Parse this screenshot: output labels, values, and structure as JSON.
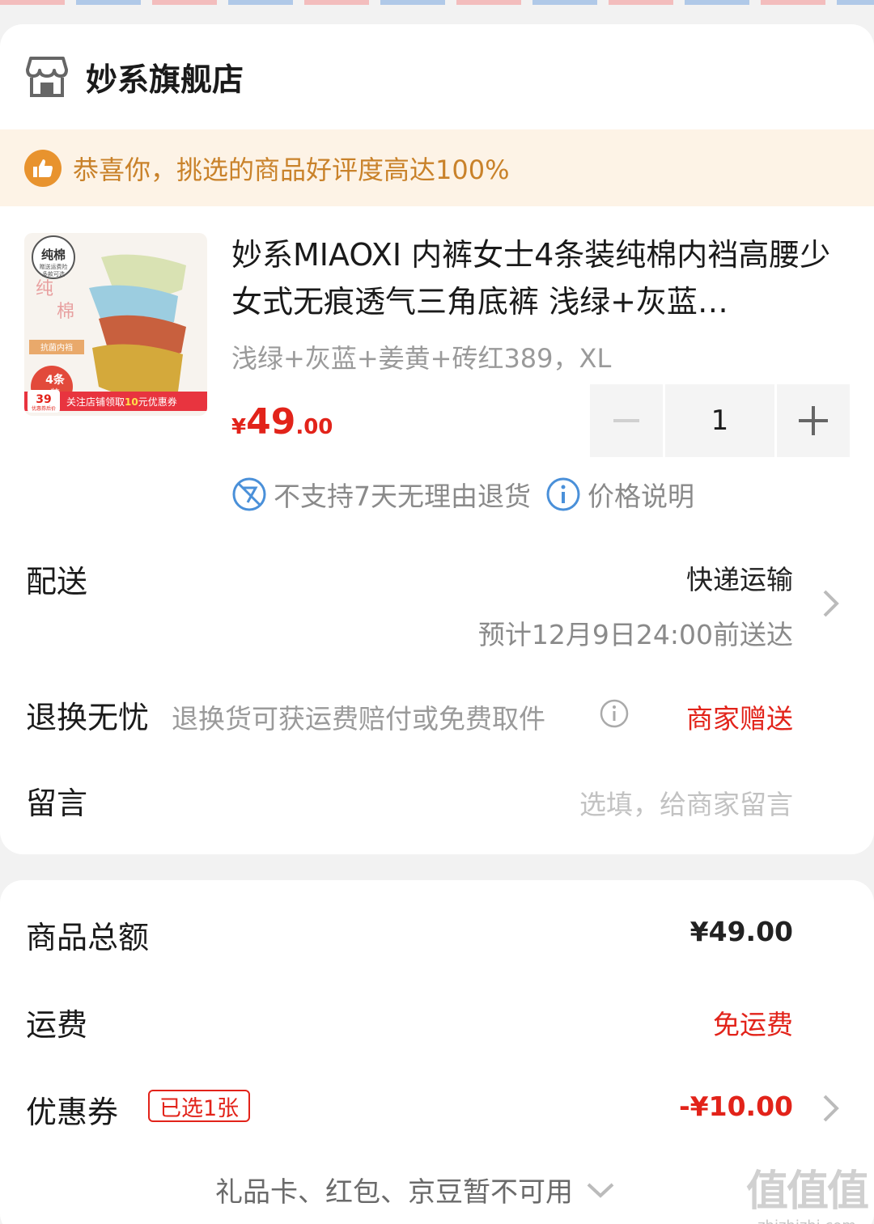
{
  "shop": {
    "name": "妙系旗舰店",
    "icon": "store-icon"
  },
  "banner": {
    "text": "恭喜你，挑选的商品好评度高达100%",
    "icon": "thumbs-up-icon"
  },
  "product": {
    "title": "妙系MIAOXI 内裤女士4条装纯棉内裆高腰少女式无痕透气三角底裤 浅绿+灰蓝…",
    "spec": "浅绿+灰蓝+姜黄+砖红389，XL",
    "price_currency": "¥",
    "price_int": "49",
    "price_dec": ".00",
    "image_texts": {
      "badge": "纯棉",
      "badge_sub1": "赠送运费险",
      "badge_sub2": "多款可选",
      "char1": "纯",
      "char2": "棉",
      "tag": "抗菌内裆",
      "count": "4条",
      "count_sub": "装",
      "sticker_price": "39",
      "sticker_sub": "优惠券后价",
      "strip_a": "关注店铺领取",
      "strip_num": "10",
      "strip_b": "元优惠券"
    }
  },
  "quantity": {
    "value": "1",
    "minus": "−",
    "plus": "+"
  },
  "notices": {
    "no_return": "不支持7天无理由退货",
    "price_info": "价格说明"
  },
  "delivery": {
    "label": "配送",
    "method": "快递运输",
    "eta": "预计12月9日24:00前送达"
  },
  "returns": {
    "label": "退换无忧",
    "desc": "退换货可获运费赔付或免费取件",
    "value": "商家赠送"
  },
  "message": {
    "label": "留言",
    "placeholder": "选填，给商家留言"
  },
  "summary": {
    "total_label": "商品总额",
    "total_value": "¥49.00",
    "shipping_label": "运费",
    "shipping_value": "免运费",
    "coupon_label": "优惠券",
    "coupon_tag": "已选1张",
    "coupon_value": "-¥10.00",
    "unavailable_note": "礼品卡、红包、京豆暂不可用"
  },
  "watermark": {
    "big": "值值值",
    "small": "zhizhizhi.com"
  },
  "colors": {
    "accent_red": "#e2231a",
    "banner_bg": "#fdf3e6",
    "banner_text": "#c9822a",
    "link_blue": "#4a90d9"
  }
}
